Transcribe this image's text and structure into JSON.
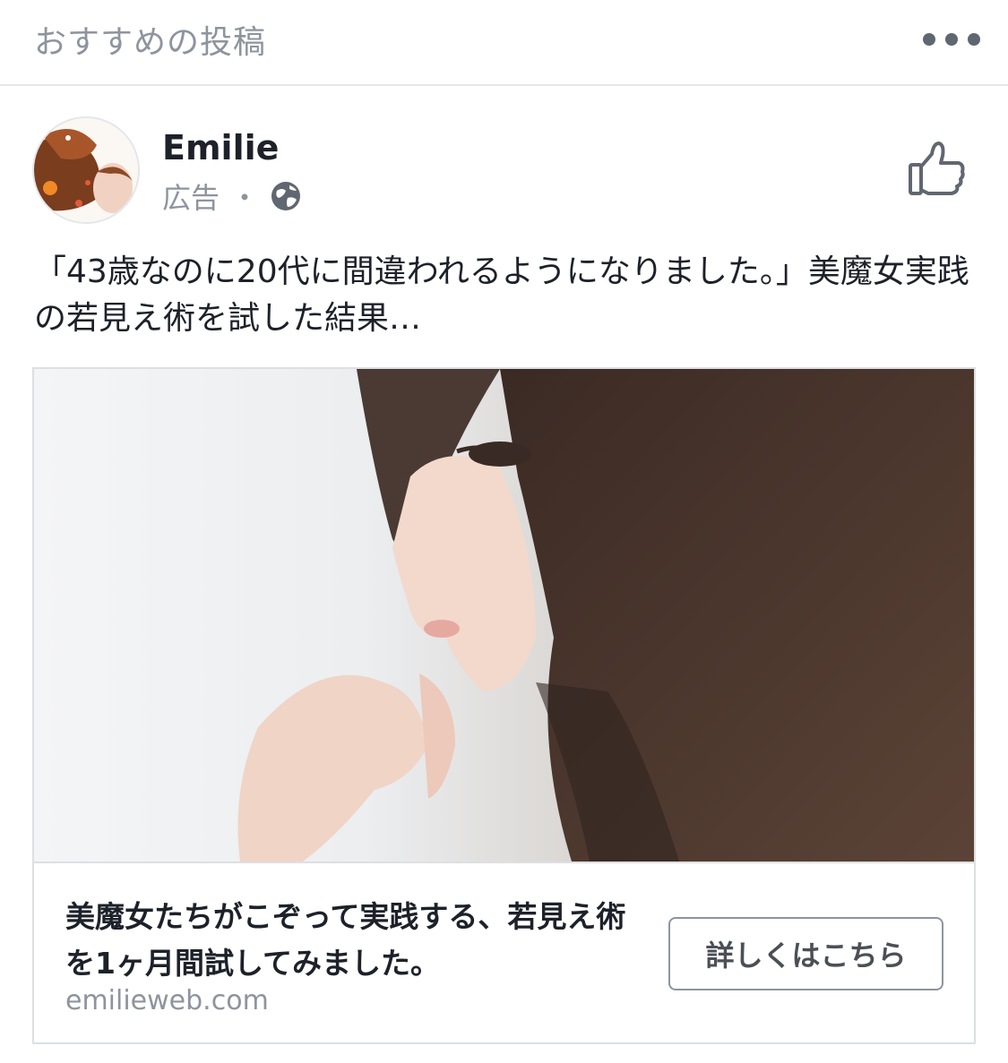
{
  "header": {
    "title": "おすすめの投稿",
    "more_icon": "more-horizontal-icon"
  },
  "post": {
    "author": "Emilie",
    "meta_label": "広告",
    "meta_separator": "・",
    "audience_icon": "globe-icon",
    "like_icon": "thumbs-up-icon",
    "text": "「43歳なのに20代に間違われるようになりました。」美魔女実践の若見え術を試した結果…"
  },
  "card": {
    "headline": "美魔女たちがこぞって実践する、若見え術を1ヶ月間試してみました。",
    "domain": "emilieweb.com",
    "cta_label": "詳しくはこちら"
  },
  "colors": {
    "text": "#1d2129",
    "muted": "#8d949e",
    "border": "#dddfe2"
  }
}
